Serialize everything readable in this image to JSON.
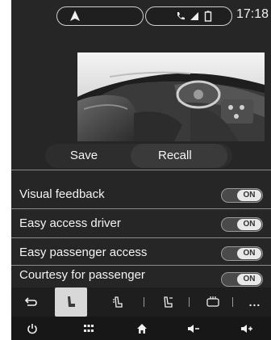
{
  "status": {
    "clock": "17:18",
    "nav_icon": "navigation-arrow-icon",
    "phone_icons": [
      "phone-icon",
      "signal-icon",
      "battery-icon"
    ]
  },
  "memory": {
    "save_label": "Save",
    "recall_label": "Recall"
  },
  "settings": [
    {
      "label": "Visual feedback",
      "state": "ON"
    },
    {
      "label": "Easy access driver",
      "state": "ON"
    },
    {
      "label": "Easy passenger access",
      "state": "ON"
    },
    {
      "label": "Courtesy for passenger",
      "state": "ON"
    }
  ],
  "function_bar": {
    "items": [
      "back-icon",
      "seat-icon",
      "seat-massage-icon",
      "seat-position-icon",
      "seat-heating-icon",
      "more-icon"
    ],
    "more_label": "..."
  },
  "bottom_bar": {
    "items": [
      "power-icon",
      "menu-grid-icon",
      "home-icon",
      "volume-down-icon",
      "volume-up-icon"
    ]
  }
}
